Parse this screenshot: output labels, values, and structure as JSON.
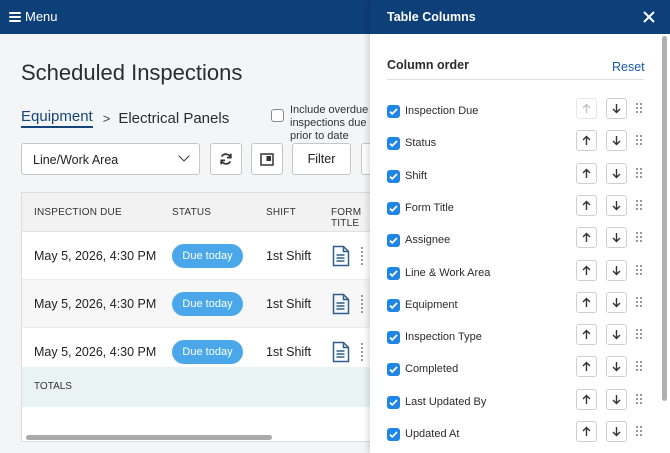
{
  "topbar": {
    "menu_label": "Menu"
  },
  "page": {
    "title": "Scheduled Inspections",
    "breadcrumb": {
      "link": "Equipment",
      "separator": ">",
      "current": "Electrical Panels"
    },
    "overdue_option": "Include overdue inspections due prior to date",
    "work_area_select": "Line/Work Area",
    "filter_label": "Filter"
  },
  "table": {
    "headers": [
      "INSPECTION DUE",
      "STATUS",
      "SHIFT",
      "FORM TITLE"
    ],
    "rows": [
      {
        "due": "May 5, 2026, 4:30 PM",
        "status": "Due today",
        "shift": "1st Shift"
      },
      {
        "due": "May 5, 2026, 4:30 PM",
        "status": "Due today",
        "shift": "1st Shift"
      },
      {
        "due": "May 5, 2026, 4:30 PM",
        "status": "Due today",
        "shift": "1st Shift"
      }
    ],
    "totals_label": "TOTALS"
  },
  "panel": {
    "title": "Table Columns",
    "section_label": "Column order",
    "reset_label": "Reset",
    "columns": [
      {
        "label": "Inspection Due",
        "checked": true
      },
      {
        "label": "Status",
        "checked": true
      },
      {
        "label": "Shift",
        "checked": true
      },
      {
        "label": "Form Title",
        "checked": true
      },
      {
        "label": "Assignee",
        "checked": true
      },
      {
        "label": "Line & Work Area",
        "checked": true
      },
      {
        "label": "Equipment",
        "checked": true
      },
      {
        "label": "Inspection Type",
        "checked": true
      },
      {
        "label": "Completed",
        "checked": true
      },
      {
        "label": "Last Updated By",
        "checked": true
      },
      {
        "label": "Updated At",
        "checked": true
      }
    ]
  },
  "colors": {
    "header_blue": "#0d3f79",
    "badge_blue": "#4aa8ea",
    "checkbox_blue": "#1e86e5",
    "link_blue": "#1a5ca8"
  },
  "icons": [
    "hamburger-icon",
    "refresh-icon",
    "layout-icon",
    "chevron-down-icon",
    "document-icon",
    "close-icon",
    "arrow-up-icon",
    "arrow-down-icon",
    "drag-handle-icon",
    "check-icon"
  ]
}
